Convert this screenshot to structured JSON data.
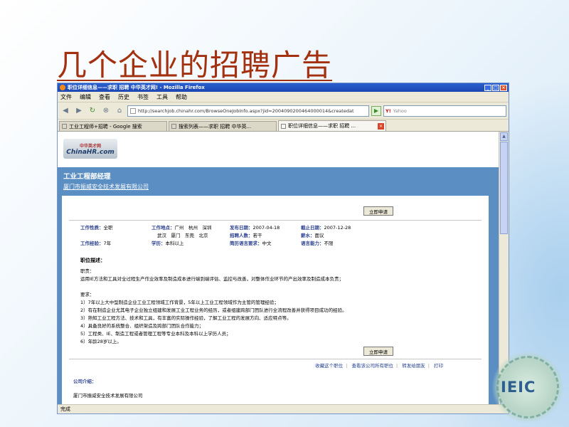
{
  "slide": {
    "title": "几个企业的招聘广告"
  },
  "browser": {
    "window_title": "职位详细信息——求职 招聘 中华英才网! - Mozilla Firefox",
    "menu": [
      "文件",
      "编辑",
      "查看",
      "历史",
      "书签",
      "工具",
      "帮助"
    ],
    "url": "http://searchjob.chinahr.com/BrowseOneJobInfo.aspx?jid=2004090200464000014&createdat",
    "search_engine": "Y!",
    "search_placeholder": "Yahoo",
    "tabs": [
      {
        "label": "工业工程师+招聘 - Google 搜索",
        "active": false
      },
      {
        "label": "搜索列表——求职 招聘 中华英...",
        "active": false
      },
      {
        "label": "职位详细信息——求职 招聘 ...",
        "active": true
      }
    ],
    "status": "完成"
  },
  "page": {
    "logo_top": "中华英才网",
    "logo_main": "ChinaHR.com",
    "job_title": "工业工程部经理",
    "company_link": "厦门市振威安全技术发展有限公司",
    "apply_label": "立即申请",
    "meta": {
      "nature_label": "工作性质：",
      "nature": "全职",
      "location_label": "工作地点：",
      "location_1": "广州　杭州　深圳",
      "location_2": "武汉　厦门　东莞　北京",
      "pub_label": "发布日期：",
      "pub": "2007-04-18",
      "deadline_label": "截止日期：",
      "deadline": "2007-12-28",
      "headcount_label": "招聘人数：",
      "headcount": "若干",
      "salary_label": "薪水：",
      "salary": "面议",
      "exp_label": "工作经验：",
      "exp": "7年",
      "edu_label": "学历：",
      "edu": "本科以上",
      "resume_lang_label": "简历语言要求：",
      "resume_lang": "中文",
      "lang_ability_label": "语言能力：",
      "lang_ability": "不限"
    },
    "desc_title": "职位描述：",
    "duty_label": "职责：",
    "duty": "运用IE方法和工具对全过程生产作业效率及制造成本进行端到端评估、监控与改善，对整体作业环节的产出效率及制造成本负责；",
    "req_label": "要求：",
    "requirements": [
      "1）7年以上大中型制造企业工业工程领域工作背景，5年以上工业工程领域作为主管的管理经验；",
      "2）有在制造企业尤其电子企业独立组建和发展工业工程业务的经历，或者组建跨部门团队进行全流程改善并获得项目成功的经验。",
      "3）熟知工业工程方法、技术和工具，有丰富的实际操作经验，了解工业工程的发展方向、适应特点等。",
      "4）具备良好的系统整合、组织架造及跨部门团队合作能力；",
      "5）工程类、IE、制造工程或者管理工程等专业本科及本科以上学历人员；",
      "6）年龄28岁以上。"
    ],
    "links": [
      "收藏这个职位",
      "查看该公司所有职位",
      "转发给朋友",
      "打印"
    ],
    "company_title": "公司介绍：",
    "company_name": "厦门市振威安全技术发展有限公司"
  },
  "badge": {
    "text": "IEIC"
  }
}
